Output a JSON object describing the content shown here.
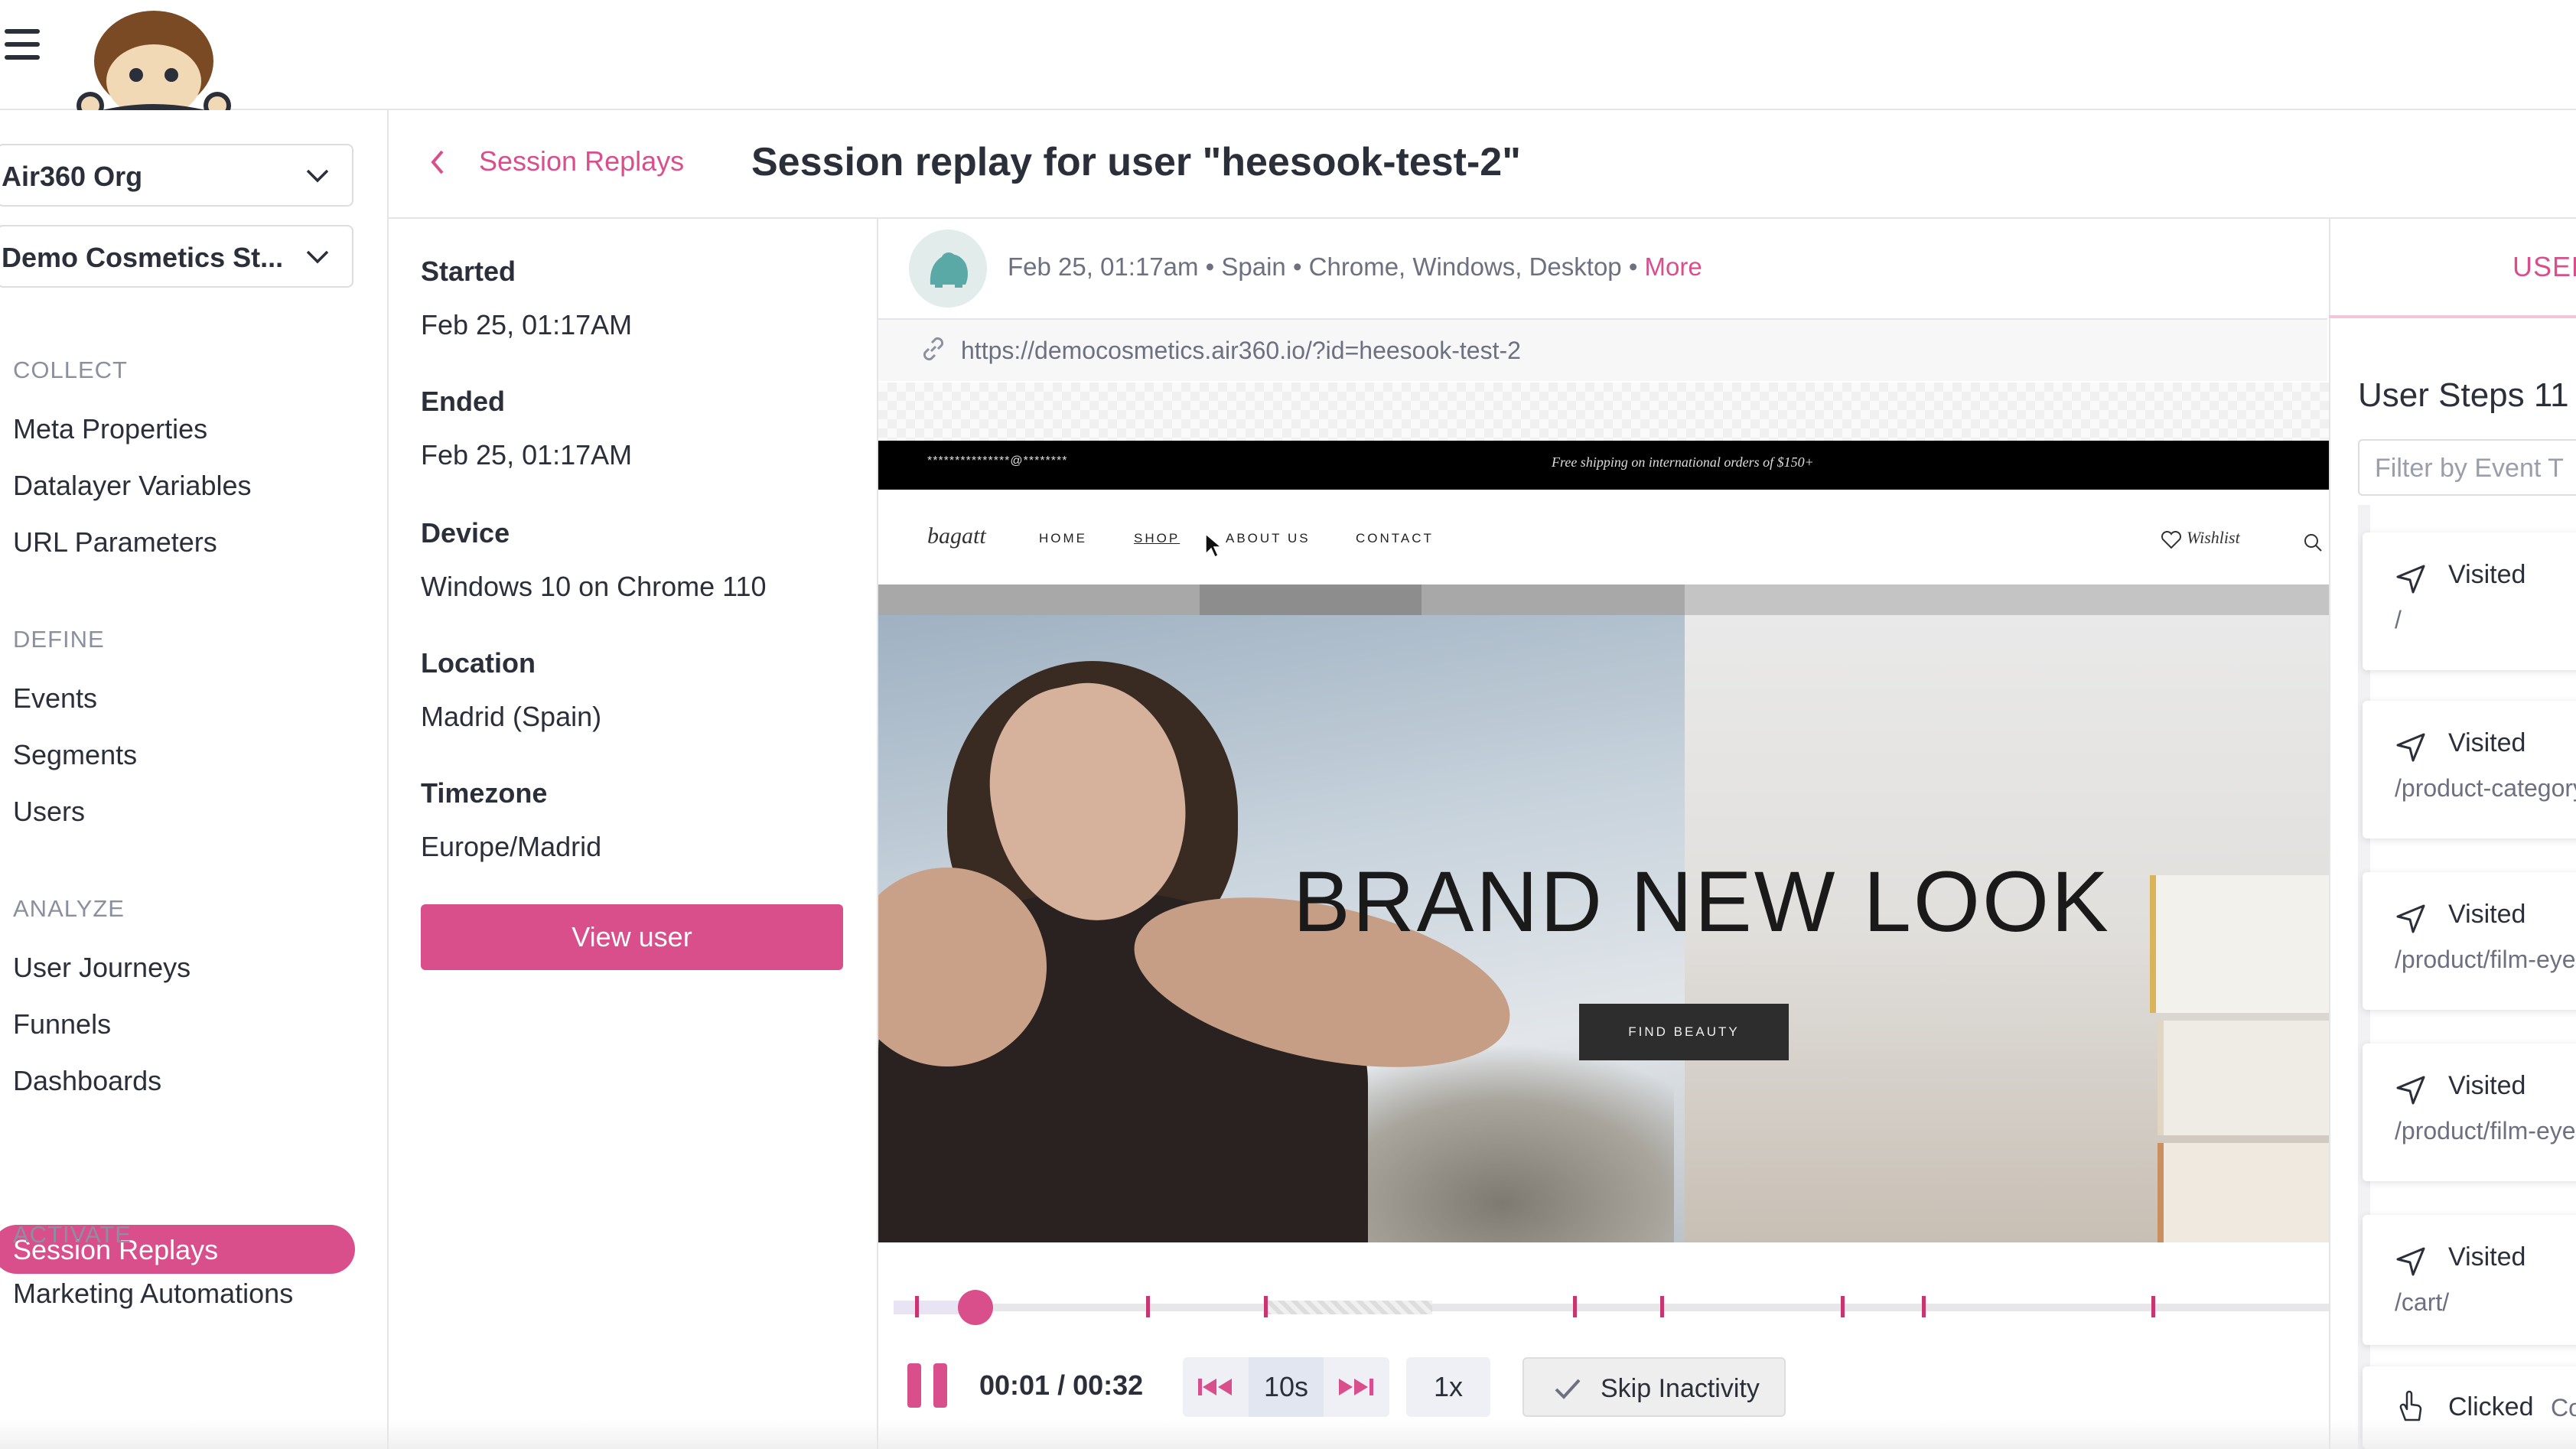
{
  "sidebar": {
    "org_select": "Air360 Org",
    "site_select": "Demo Cosmetics St...",
    "sections": {
      "collect": "COLLECT",
      "define": "DEFINE",
      "analyze": "ANALYZE",
      "activate": "ACTIVATE"
    },
    "items": {
      "meta_properties": "Meta Properties",
      "datalayer_variables": "Datalayer Variables",
      "url_parameters": "URL Parameters",
      "events": "Events",
      "segments": "Segments",
      "users": "Users",
      "user_journeys": "User Journeys",
      "funnels": "Funnels",
      "dashboards": "Dashboards",
      "session_replays": "Session Replays",
      "marketing_automations": "Marketing Automations"
    }
  },
  "header": {
    "back_label": "Session Replays",
    "title": "Session replay for user \"heesook-test-2\""
  },
  "details": {
    "started_label": "Started",
    "started_value": "Feb 25, 01:17AM",
    "ended_label": "Ended",
    "ended_value": "Feb 25, 01:17AM",
    "device_label": "Device",
    "device_value": "Windows 10 on Chrome 110",
    "location_label": "Location",
    "location_value": "Madrid (Spain)",
    "timezone_label": "Timezone",
    "timezone_value": "Europe/Madrid",
    "view_user_button": "View user"
  },
  "session_meta": {
    "summary": "Feb 25, 01:17am • Spain • Chrome, Windows, Desktop • ",
    "more_link": "More",
    "url": "https://democosmetics.air360.io/?id=heesook-test-2"
  },
  "replayed_site": {
    "promo_left": "***************@********",
    "promo_right": "Free shipping on international orders of $150+",
    "logo_text": "bagatt",
    "nav": {
      "home": "HOME",
      "shop": "SHOP",
      "about": "ABOUT US",
      "contact": "CONTACT"
    },
    "wishlist": "Wishlist",
    "headline": "BRAND NEW LOOK",
    "cta": "FIND BEAUTY"
  },
  "player": {
    "progress": 0.03,
    "current_time": "00:01",
    "total_time": "00:32",
    "timecode": "00:01 / 00:32",
    "skip_step": "10s",
    "speed": "1x",
    "skip_inactivity": "Skip Inactivity",
    "copy_fragment": "CO",
    "event_markers_count": 13
  },
  "right_panel": {
    "tab": "USER",
    "steps_title": "User Steps 11",
    "filter_placeholder": "Filter by Event T",
    "steps": [
      {
        "action": "Visited",
        "path": "/"
      },
      {
        "action": "Visited",
        "path": "/product-category"
      },
      {
        "action": "Visited",
        "path": "/product/film-eye"
      },
      {
        "action": "Visited",
        "path": "/product/film-eye"
      },
      {
        "action": "Visited",
        "path": "/cart/"
      },
      {
        "action": "Clicked",
        "path": "Co"
      }
    ]
  },
  "colors": {
    "accent": "#d94f8c",
    "text": "#2b2f3a",
    "muted": "#8b90a0"
  }
}
